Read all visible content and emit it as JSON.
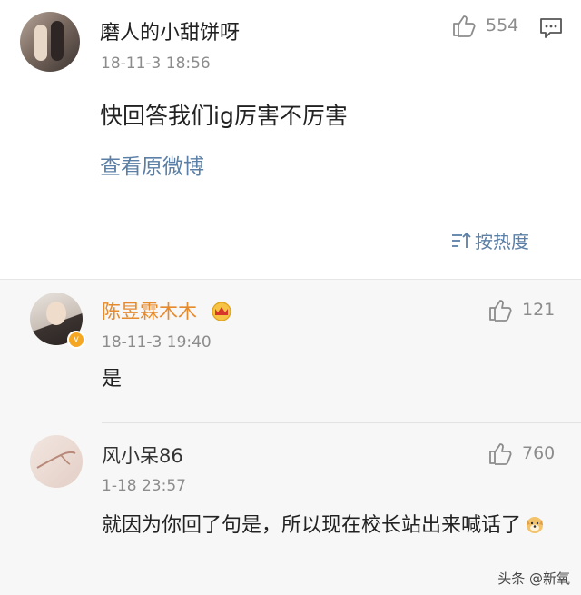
{
  "post": {
    "username": "磨人的小甜饼呀",
    "time": "18-11-3 18:56",
    "text": "快回答我们ig厉害不厉害",
    "view_original": "查看原微博",
    "likes": "554",
    "sort_label": "按热度"
  },
  "comments": [
    {
      "username": "陈昱霖木木",
      "time": "18-11-3 19:40",
      "text": "是",
      "likes": "121",
      "name_color": "#e68a2e",
      "verified": true
    },
    {
      "username": "风小呆86",
      "time": "1-18 23:57",
      "text": "就因为你回了句是，所以现在校长站出来喊话了",
      "likes": "760",
      "name_color": "#333333",
      "verified": false
    }
  ],
  "watermark": "头条 @新氧",
  "icons": {
    "like": "thumb-up-icon",
    "comment": "comment-icon",
    "sort": "sort-icon",
    "crown": "crown-badge-icon",
    "dog": "dog-emoji-icon",
    "verified": "verified-badge-icon"
  },
  "colors": {
    "link": "#5b7fa6",
    "muted": "#8c8c8c",
    "comments_bg": "#f7f7f7"
  }
}
